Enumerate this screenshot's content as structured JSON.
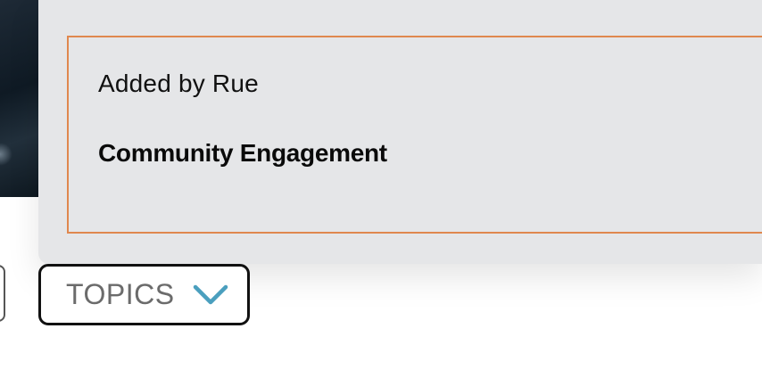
{
  "card": {
    "added_by": "Added by Rue",
    "tag_title": "Community Engagement"
  },
  "filters": {
    "topics_label": "TOPICS",
    "topics_icon": "chevron-down-icon",
    "accent_color": "#4a9fbe"
  },
  "colors": {
    "card_background": "#e5e6e8",
    "box_border": "#e0884f"
  }
}
